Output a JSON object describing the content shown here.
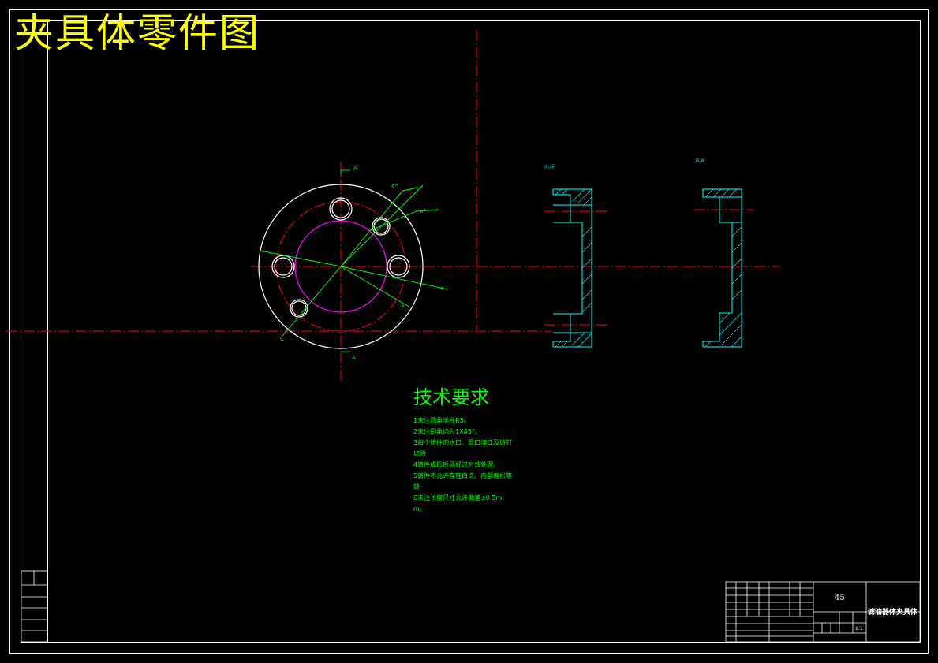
{
  "drawing": {
    "title": "夹具体零件图",
    "section_labels": {
      "top": "A",
      "bottom": "A",
      "c": "C"
    }
  },
  "tech_requirements": {
    "heading": "技术要求",
    "items": [
      "1未注圆角半径R5。",
      "2未注倒角均为1X45°。",
      "3每个铸件的水口、冒口浇口及铸钉切除",
      "4铸件成形后须经过时效处理,",
      "5铸件不允许存在白点、内部缩松等缺",
      "6未注长度尺寸允许偏差±0.5mm。"
    ]
  },
  "title_block": {
    "material": "45",
    "part_name": "滤油器体夹具体",
    "scale": "1:1"
  },
  "colors": {
    "frame": "#ffffff",
    "center_line": "#ff0000",
    "dimension": "#00ff00",
    "hatch": "#00ffff",
    "title": "#ffff00",
    "hidden_circle": "#ff00ff"
  }
}
